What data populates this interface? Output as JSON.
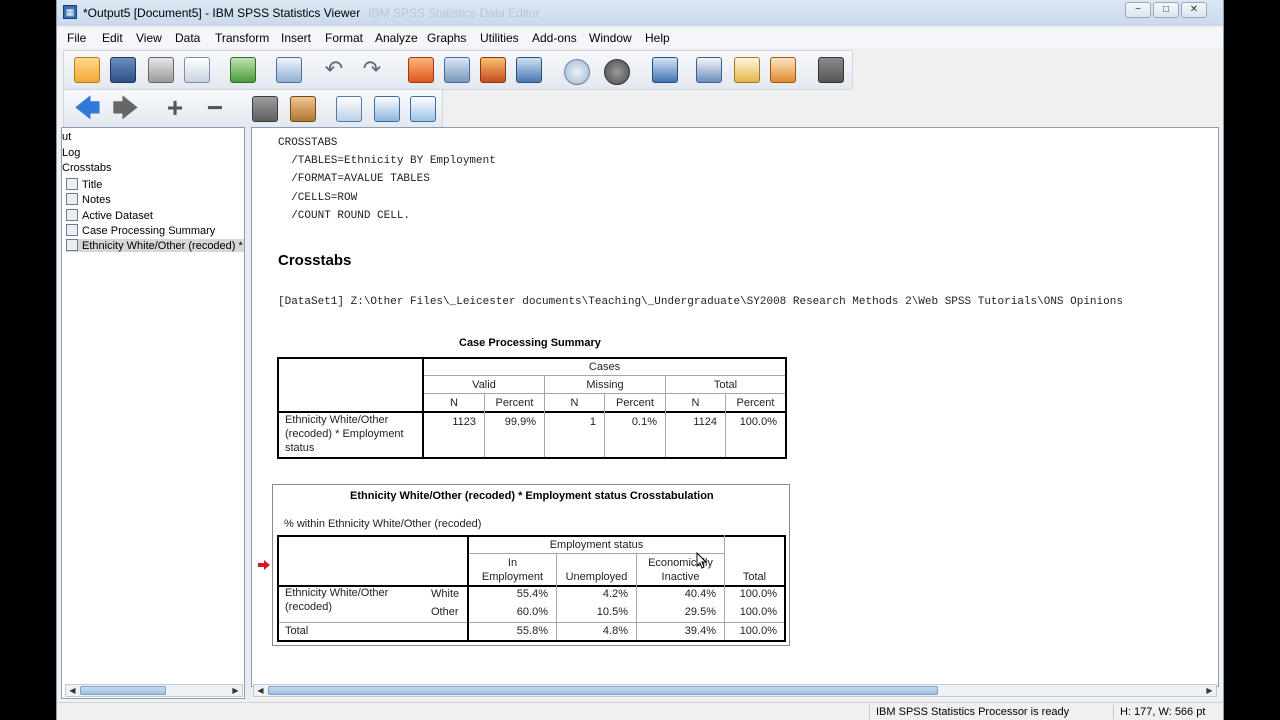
{
  "window": {
    "title": "*Output5 [Document5] - IBM SPSS Statistics Viewer",
    "ghost_title": "IBM SPSS Statistics Data Editor",
    "minimize": "−",
    "maximize": "□",
    "close": "✕"
  },
  "menu": [
    "File",
    "Edit",
    "View",
    "Data",
    "Transform",
    "Insert",
    "Format",
    "Analyze",
    "Graphs",
    "Utilities",
    "Add-ons",
    "Window",
    "Help"
  ],
  "toolbar1": [
    "open-icon",
    "save-icon",
    "print-icon",
    "print-preview-icon",
    "export-icon",
    "recall-dialog-icon",
    "undo-icon",
    "redo-icon",
    "goto-data-icon",
    "goto-case-icon",
    "goto-variable-icon",
    "variables-icon",
    "use-sets-icon",
    "show-all-variables-icon",
    "spell-check-icon",
    "insert-chart-icon",
    "insert-text-icon",
    "insert-table-icon",
    "show-hide-icon",
    "designate-window-icon"
  ],
  "toolbar2": [
    "promote-icon",
    "demote-icon",
    "expand-icon",
    "collapse-icon",
    "show-icon",
    "hide-icon",
    "insert-heading-icon",
    "insert-title-icon",
    "insert-text-icon"
  ],
  "outline": {
    "items": [
      "ut",
      "Log",
      "Crosstabs",
      "Title",
      "Notes",
      "Active Dataset",
      "Case Processing Summary",
      "Ethnicity White/Other (recoded) *"
    ],
    "selected_index": 7
  },
  "syntax": [
    "CROSSTABS",
    "  /TABLES=Ethnicity BY Employment",
    "  /FORMAT=AVALUE TABLES",
    "  /CELLS=ROW",
    "  /COUNT ROUND CELL."
  ],
  "heading": "Crosstabs",
  "dataset_path": "[DataSet1] Z:\\Other Files\\_Leicester documents\\Teaching\\_Undergraduate\\SY2008 Research Methods 2\\Web SPSS Tutorials\\ONS Opinions",
  "case_summary": {
    "title": "Case Processing Summary",
    "cases_label": "Cases",
    "groups": [
      "Valid",
      "Missing",
      "Total"
    ],
    "subheads": [
      "N",
      "Percent",
      "N",
      "Percent",
      "N",
      "Percent"
    ],
    "row_label": [
      "Ethnicity White/Other",
      "(recoded) * Employment",
      "status"
    ],
    "values": [
      "1123",
      "99.9%",
      "1",
      "0.1%",
      "1124",
      "100.0%"
    ]
  },
  "crosstab": {
    "title": "Ethnicity White/Other (recoded) * Employment status Crosstabulation",
    "subtitle": "% within Ethnicity White/Other (recoded)",
    "col_group": "Employment status",
    "col_heads": [
      [
        "In",
        "Employment"
      ],
      [
        "",
        "Unemployed"
      ],
      [
        "Economically",
        "Inactive"
      ],
      [
        "",
        "Total"
      ]
    ],
    "row_var": [
      "Ethnicity White/Other",
      "(recoded)"
    ],
    "rows": [
      {
        "label": "White",
        "values": [
          "55.4%",
          "4.2%",
          "40.4%",
          "100.0%"
        ]
      },
      {
        "label": "Other",
        "values": [
          "60.0%",
          "10.5%",
          "29.5%",
          "100.0%"
        ]
      },
      {
        "label": "Total",
        "values": [
          "55.8%",
          "4.8%",
          "39.4%",
          "100.0%"
        ]
      }
    ]
  },
  "status": {
    "processor": "IBM SPSS Statistics Processor is ready",
    "dims": "H: 177, W: 566 pt"
  },
  "colors": {
    "selection_arrow": "#d0182a",
    "accent": "#3a6db3"
  }
}
